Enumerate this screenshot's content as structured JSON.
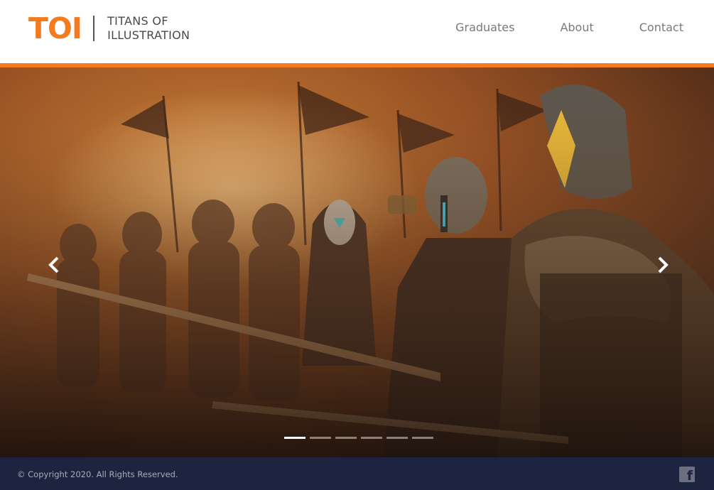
{
  "header": {
    "logo_mark": "TOI",
    "logo_line1": "TITANS OF",
    "logo_line2": "ILLUSTRATION",
    "nav": [
      {
        "label": "Graduates"
      },
      {
        "label": "About"
      },
      {
        "label": "Contact"
      }
    ]
  },
  "hero": {
    "prev_icon": "chevron-left-icon",
    "next_icon": "chevron-right-icon",
    "slide_count": 6,
    "active_slide": 1
  },
  "footer": {
    "copyright": "© Copyright 2020. All Rights Reserved.",
    "social_icon": "facebook-icon"
  },
  "colors": {
    "brand_orange": "#f47b20",
    "footer_navy": "#1d2440"
  }
}
